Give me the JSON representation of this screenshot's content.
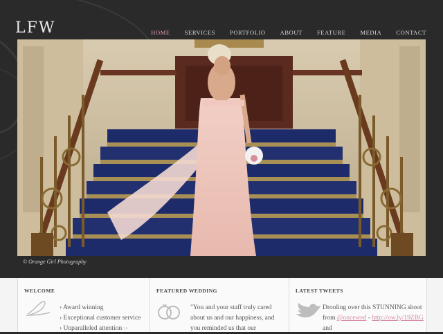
{
  "brand": {
    "logo": "LFW"
  },
  "nav": {
    "items": [
      {
        "label": "HOME",
        "active": true
      },
      {
        "label": "SERVICES"
      },
      {
        "label": "PORTFOLIO"
      },
      {
        "label": "ABOUT"
      },
      {
        "label": "FEATURE"
      },
      {
        "label": "MEDIA"
      },
      {
        "label": "CONTACT"
      }
    ]
  },
  "hero": {
    "caption": "© Orange Girl Photography"
  },
  "welcome": {
    "heading": "WELCOME",
    "items": [
      "› Award winning",
      "› Exceptional customer service",
      "› Unparalleled attention"
    ],
    "more": "››"
  },
  "featured": {
    "heading": "FEATURED WEDDING",
    "text": "\"You and your staff truly cared about us and our happiness, and you reminded us that our"
  },
  "tweets": {
    "heading": "LATEST TWEETS",
    "text_before": "Drooling over this STUNNING shoot from",
    "handle": "@oncewed",
    "dash": " -",
    "link": "http://ow.ly/19ZBG",
    "after": " and"
  },
  "colors": {
    "accent": "#e79ab2",
    "background": "#2a2a2a",
    "link": "#d68aa4"
  }
}
